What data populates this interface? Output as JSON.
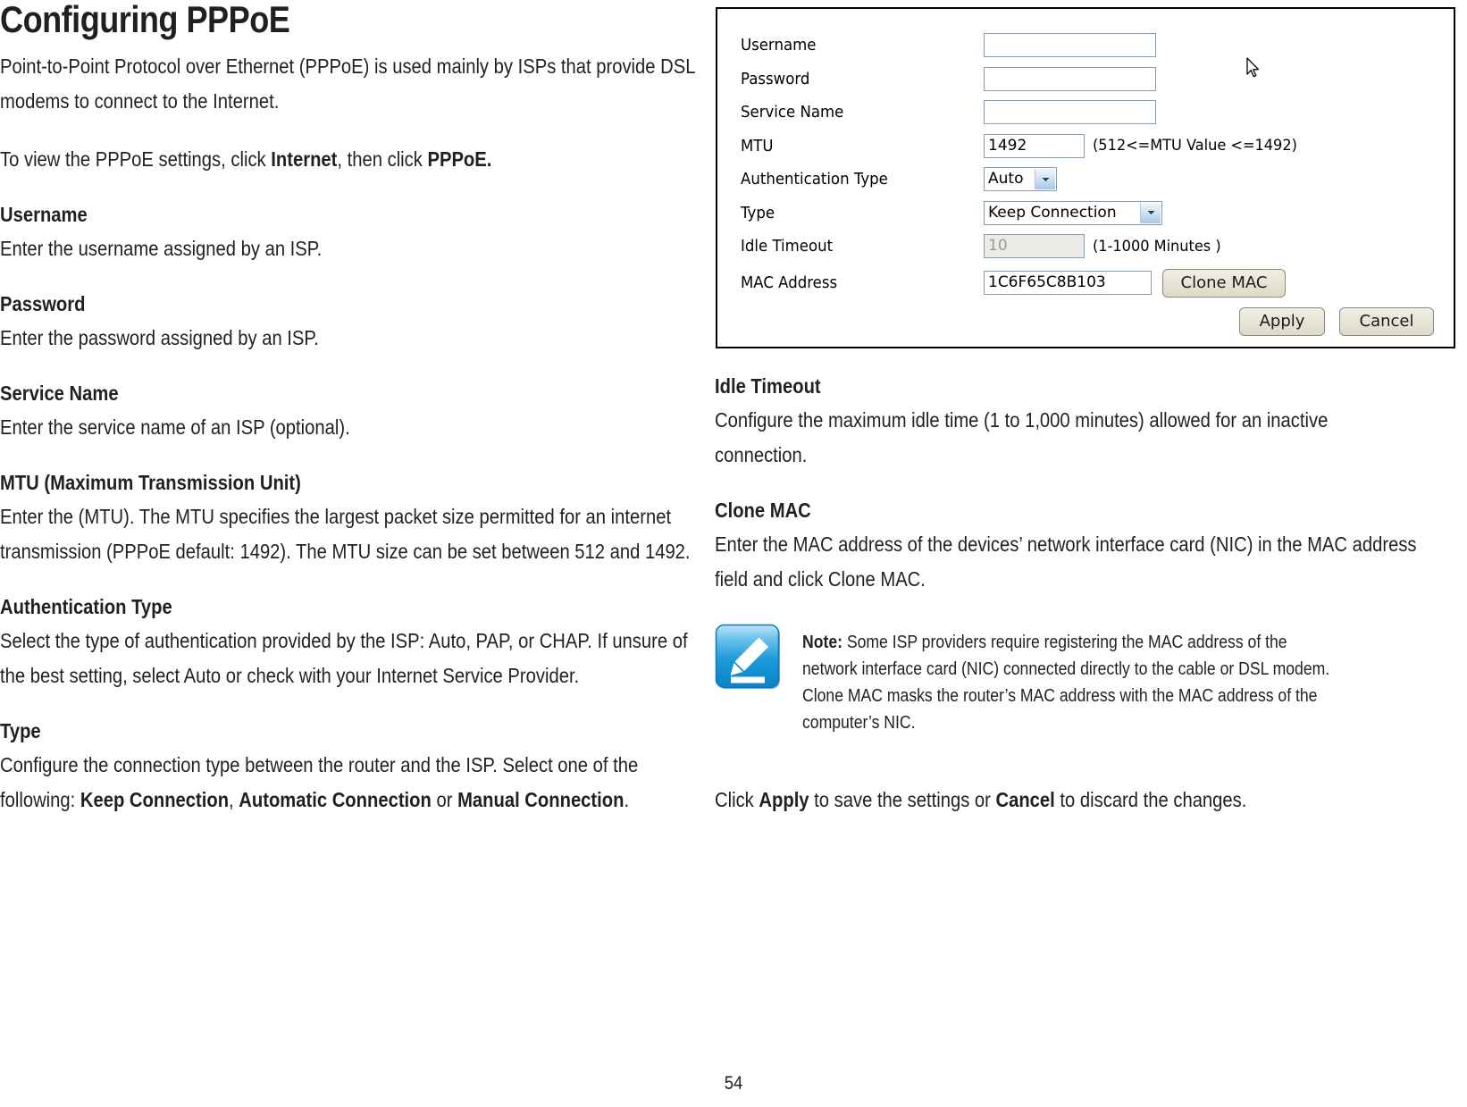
{
  "document": {
    "title": "Configuring PPPoE",
    "page_number": "54"
  },
  "left_column": {
    "intro_paragraph": "Point-to-Point Protocol over Ethernet (PPPoE) is used mainly by ISPs that provide DSL modems to connect to the Internet.",
    "view_instruction": {
      "prefix": "To view the PPPoE settings, click ",
      "bold_1": "Internet",
      "middle": ", then click ",
      "bold_2": "PPPoE."
    },
    "sections": [
      {
        "heading": "Username",
        "text": "Enter the username assigned by an ISP."
      },
      {
        "heading": "Password",
        "text": "Enter the password assigned by an ISP."
      },
      {
        "heading": "Service Name",
        "text": "Enter the service name of an ISP (optional)."
      },
      {
        "heading": "MTU (Maximum Transmission Unit)",
        "text": "Enter the (MTU). The MTU specifies the largest packet size permitted for an internet transmission (PPPoE default: 1492). The MTU size can be set between 512 and 1492."
      },
      {
        "heading": "Authentication Type",
        "text": "Select the type of authentication provided by the ISP: Auto, PAP, or CHAP. If unsure of the best setting, select Auto or check with your Internet Service Provider."
      }
    ],
    "type_section": {
      "heading": "Type",
      "prefix": "Configure the connection type between the router and the ISP. Select one of the following: ",
      "bold_1": "Keep Connection",
      "sep_1": ", ",
      "bold_2": "Automatic Connection",
      "sep_2": " or ",
      "bold_3": "Manual Connection",
      "suffix": "."
    }
  },
  "router_screenshot": {
    "fields": [
      {
        "label": "Username",
        "control": "text",
        "value": "",
        "hint": ""
      },
      {
        "label": "Password",
        "control": "text",
        "value": "",
        "hint": ""
      },
      {
        "label": "Service Name",
        "control": "text",
        "value": "",
        "hint": ""
      },
      {
        "label": "MTU",
        "control": "text",
        "value": "1492",
        "hint": "(512<=MTU Value <=1492)"
      },
      {
        "label": "Authentication Type",
        "control": "select",
        "value": "Auto",
        "hint": ""
      },
      {
        "label": "Type",
        "control": "select",
        "value": "Keep Connection",
        "hint": ""
      },
      {
        "label": "Idle Timeout",
        "control": "text",
        "value": "10",
        "hint": "(1-1000 Minutes )"
      },
      {
        "label": "MAC Address",
        "control": "text",
        "value": "1C6F65C8B103",
        "hint": ""
      }
    ],
    "clone_mac_button": "Clone MAC",
    "apply_button": "Apply",
    "cancel_button": "Cancel"
  },
  "right_column": {
    "sections": [
      {
        "heading": "Idle Timeout",
        "text": "Configure the maximum idle time (1 to 1,000 minutes) allowed for an inactive connection."
      },
      {
        "heading": "Clone MAC",
        "text": "Enter the MAC address of the devices’ network interface card (NIC) in the MAC address field and click Clone MAC."
      }
    ],
    "note": {
      "label": "Note:",
      "text": " Some ISP providers require registering the MAC address of the network interface card (NIC) connected directly to the cable or DSL modem. Clone MAC masks the router’s MAC address with the MAC address of the computer’s NIC."
    },
    "closing": {
      "prefix": "Click ",
      "bold_1": "Apply",
      "middle": " to save the settings or ",
      "bold_2": "Cancel",
      "suffix": " to discard the changes."
    }
  },
  "colors": {
    "note_icon_blue": "#0f8ed4",
    "input_border": "#7f9db9",
    "button_face": "#e6e3d4",
    "text": "#231f20"
  }
}
